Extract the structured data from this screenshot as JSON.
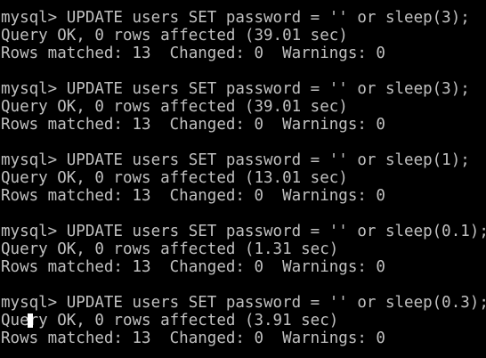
{
  "colors": {
    "background": "#000000",
    "text": "#c0c0c0",
    "cursor": "#ffffff"
  },
  "terminal": {
    "lines": [
      "mysql> UPDATE users SET password = '' or sleep(3);",
      "Query OK, 0 rows affected (39.01 sec)",
      "Rows matched: 13  Changed: 0  Warnings: 0",
      "",
      "mysql> UPDATE users SET password = '' or sleep(3);",
      "Query OK, 0 rows affected (39.01 sec)",
      "Rows matched: 13  Changed: 0  Warnings: 0",
      "",
      "mysql> UPDATE users SET password = '' or sleep(1);",
      "Query OK, 0 rows affected (13.01 sec)",
      "Rows matched: 13  Changed: 0  Warnings: 0",
      "",
      "mysql> UPDATE users SET password = '' or sleep(0.1);",
      "Query OK, 0 rows affected (1.31 sec)",
      "Rows matched: 13  Changed: 0  Warnings: 0",
      "",
      "mysql> UPDATE users SET password = '' or sleep(0.3);",
      "Query OK, 0 rows affected (3.91 sec)",
      "Rows matched: 13  Changed: 0  Warnings: 0"
    ]
  }
}
